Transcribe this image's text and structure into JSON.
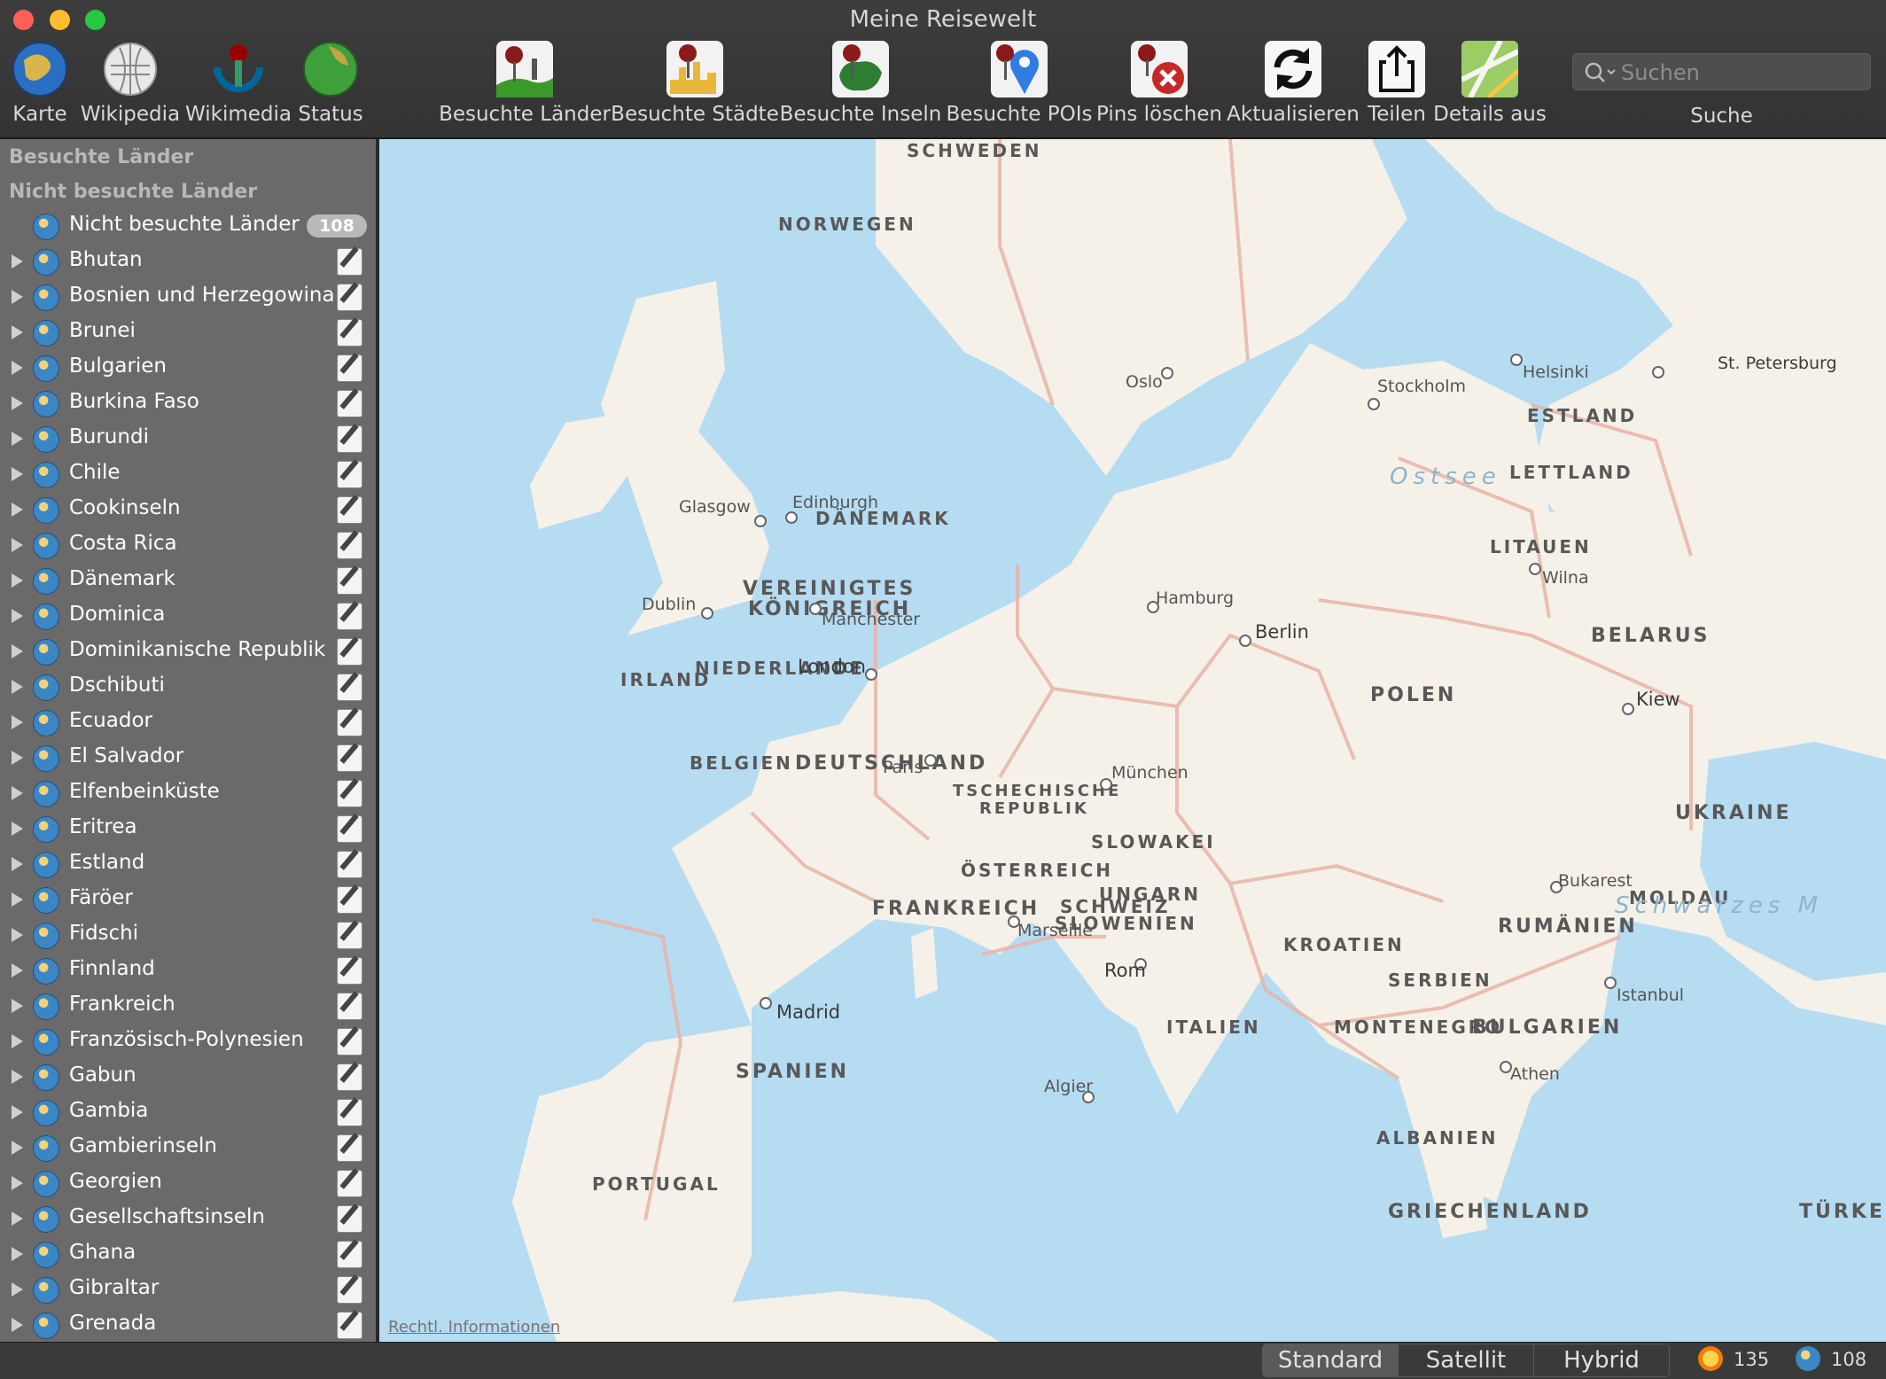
{
  "window": {
    "title": "Meine Reisewelt"
  },
  "toolbar": {
    "left_items": [
      {
        "label": "Karte",
        "icon": "globe-icon"
      },
      {
        "label": "Wikipedia",
        "icon": "wikipedia-globe-icon"
      },
      {
        "label": "Wikimedia",
        "icon": "wikimedia-icon"
      },
      {
        "label": "Status",
        "icon": "status-globe-icon"
      }
    ],
    "right_items": [
      {
        "label": "Besuchte Länder",
        "icon": "pin-landscape-icon"
      },
      {
        "label": "Besuchte Städte",
        "icon": "pin-city-icon"
      },
      {
        "label": "Besuchte Inseln",
        "icon": "pin-island-icon"
      },
      {
        "label": "Besuchte POIs",
        "icon": "pin-poi-icon"
      },
      {
        "label": "Pins löschen",
        "icon": "pin-delete-icon"
      },
      {
        "label": "Aktualisieren",
        "icon": "refresh-icon"
      },
      {
        "label": "Teilen",
        "icon": "share-icon"
      },
      {
        "label": "Details aus",
        "icon": "map-details-icon"
      }
    ],
    "search": {
      "placeholder": "Suchen",
      "label": "Suche"
    }
  },
  "sidebar": {
    "sections": [
      "Besuchte Länder",
      "Nicht besuchte Länder"
    ],
    "group": {
      "label": "Nicht besuchte Länder",
      "count": "108"
    },
    "countries": [
      "Bhutan",
      "Bosnien und Herzegowina",
      "Brunei",
      "Bulgarien",
      "Burkina Faso",
      "Burundi",
      "Chile",
      "Cookinseln",
      "Costa Rica",
      "Dänemark",
      "Dominica",
      "Dominikanische Republik",
      "Dschibuti",
      "Ecuador",
      "El Salvador",
      "Elfenbeinküste",
      "Eritrea",
      "Estland",
      "Färöer",
      "Fidschi",
      "Finnland",
      "Frankreich",
      "Französisch-Polynesien",
      "Gabun",
      "Gambia",
      "Gambierinseln",
      "Georgien",
      "Gesellschaftsinseln",
      "Ghana",
      "Gibraltar",
      "Grenada"
    ]
  },
  "map": {
    "countries": [
      "SCHWEDEN",
      "NORWEGEN",
      "ESTLAND",
      "LETTLAND",
      "DÄNEMARK",
      "LITAUEN",
      "VEREINIGTES",
      "KÖNIGREICH",
      "BELARUS",
      "IRLAND",
      "NIEDERLANDE",
      "POLEN",
      "BELGIEN",
      "DEUTSCHLAND",
      "TSCHECHISCHE",
      "REPUBLIK",
      "UKRAINE",
      "SLOWAKEI",
      "ÖSTERREICH",
      "FRANKREICH",
      "SCHWEIZ",
      "UNGARN",
      "MOLDAU",
      "SLOWENIEN",
      "RUMÄNIEN",
      "KROATIEN",
      "SERBIEN",
      "ITALIEN",
      "MONTENEGRO",
      "BULGARIEN",
      "SPANIEN",
      "ALBANIEN",
      "PORTUGAL",
      "GRIECHENLAND",
      "TÜRKEI"
    ],
    "cities": [
      "Oslo",
      "Stockholm",
      "Helsinki",
      "St. Petersburg",
      "Glasgow",
      "Edinburgh",
      "Wilna",
      "Dublin",
      "Manchester",
      "Hamburg",
      "Berlin",
      "London",
      "Kiew",
      "Paris",
      "München",
      "Bukarest",
      "Marseille",
      "Rom",
      "Istanbul",
      "Madrid",
      "Athen",
      "Algier"
    ],
    "seas": [
      "Ostsee",
      "Schwarzes M"
    ],
    "legal": "Rechtl. Informationen"
  },
  "statusbar": {
    "segments": [
      "Standard",
      "Satellit",
      "Hybrid"
    ],
    "selected": "Standard",
    "visited_count": "135",
    "unvisited_count": "108"
  }
}
